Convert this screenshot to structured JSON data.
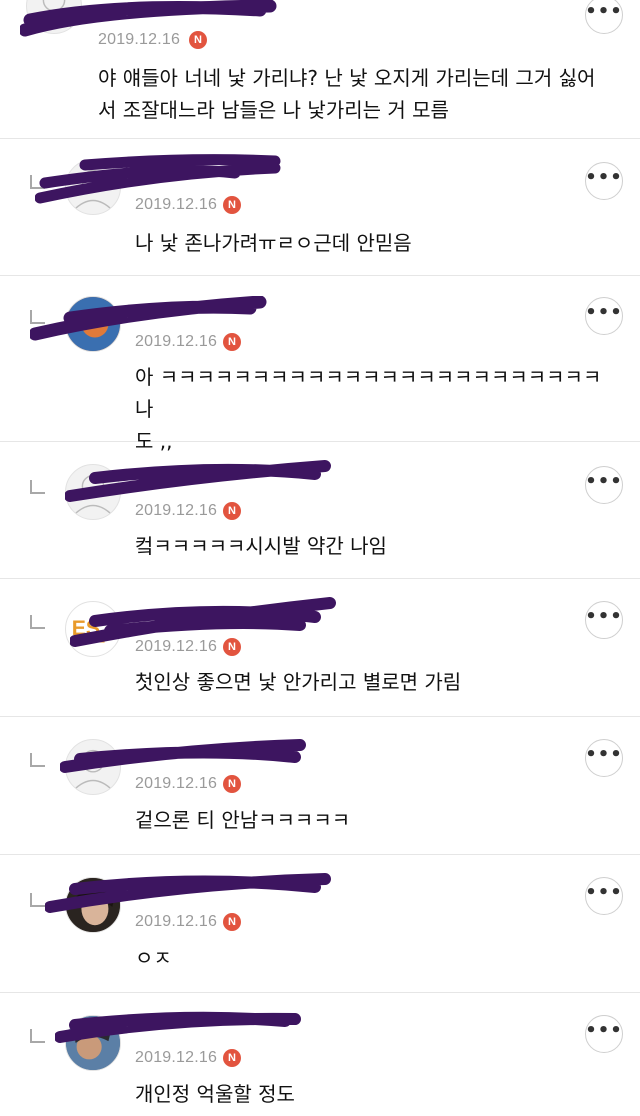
{
  "comments": [
    {
      "date": "2019.12.16",
      "badge": "N",
      "text": "야 얘들아 너네 낯 가리냐? 난 낯 오지게 가리는데 그거 싫어\n서 조잘대느라 남들은 나 낯가리는 거 모름",
      "reply": false,
      "avatar_icon": "default-avatar-icon"
    },
    {
      "date": "2019.12.16",
      "badge": "N",
      "text": "나 낯 존나가려ㅠㄹㅇ근데 안믿음",
      "reply": true,
      "avatar_icon": "default-avatar-icon"
    },
    {
      "date": "2019.12.16",
      "badge": "N",
      "text": "아 ㅋㅋㅋㅋㅋㅋㅋㅋㅋㅋㅋㅋㅋㅋㅋㅋㅋㅋㅋㅋㅋㅋㅋㅋ 나\n도 ,,",
      "reply": true,
      "avatar_icon": "photo-avatar-icon"
    },
    {
      "date": "2019.12.16",
      "badge": "N",
      "text": "컼ㅋㅋㅋㅋㅋ시시발 약간 나임",
      "reply": true,
      "avatar_icon": "default-avatar-icon"
    },
    {
      "date": "2019.12.16",
      "badge": "N",
      "text": "첫인상 좋으면 낯 안가리고 별로면 가림",
      "reply": true,
      "avatar_icon": "logo-avatar-icon"
    },
    {
      "date": "2019.12.16",
      "badge": "N",
      "text": "겉으론 티 안남ㅋㅋㅋㅋㅋ",
      "reply": true,
      "avatar_icon": "default-avatar-icon"
    },
    {
      "date": "2019.12.16",
      "badge": "N",
      "text": "ㅇㅈ",
      "reply": true,
      "avatar_icon": "photo-avatar-icon"
    },
    {
      "date": "2019.12.16",
      "badge": "N",
      "text": "개인정 억울할 정도",
      "reply": true,
      "avatar_icon": "photo-avatar-icon"
    }
  ],
  "more_label": "•••",
  "colors": {
    "badge": "#e2543f",
    "scribble": "#3d1560",
    "date": "#9a9a9a",
    "divider": "#e6e6e6"
  }
}
